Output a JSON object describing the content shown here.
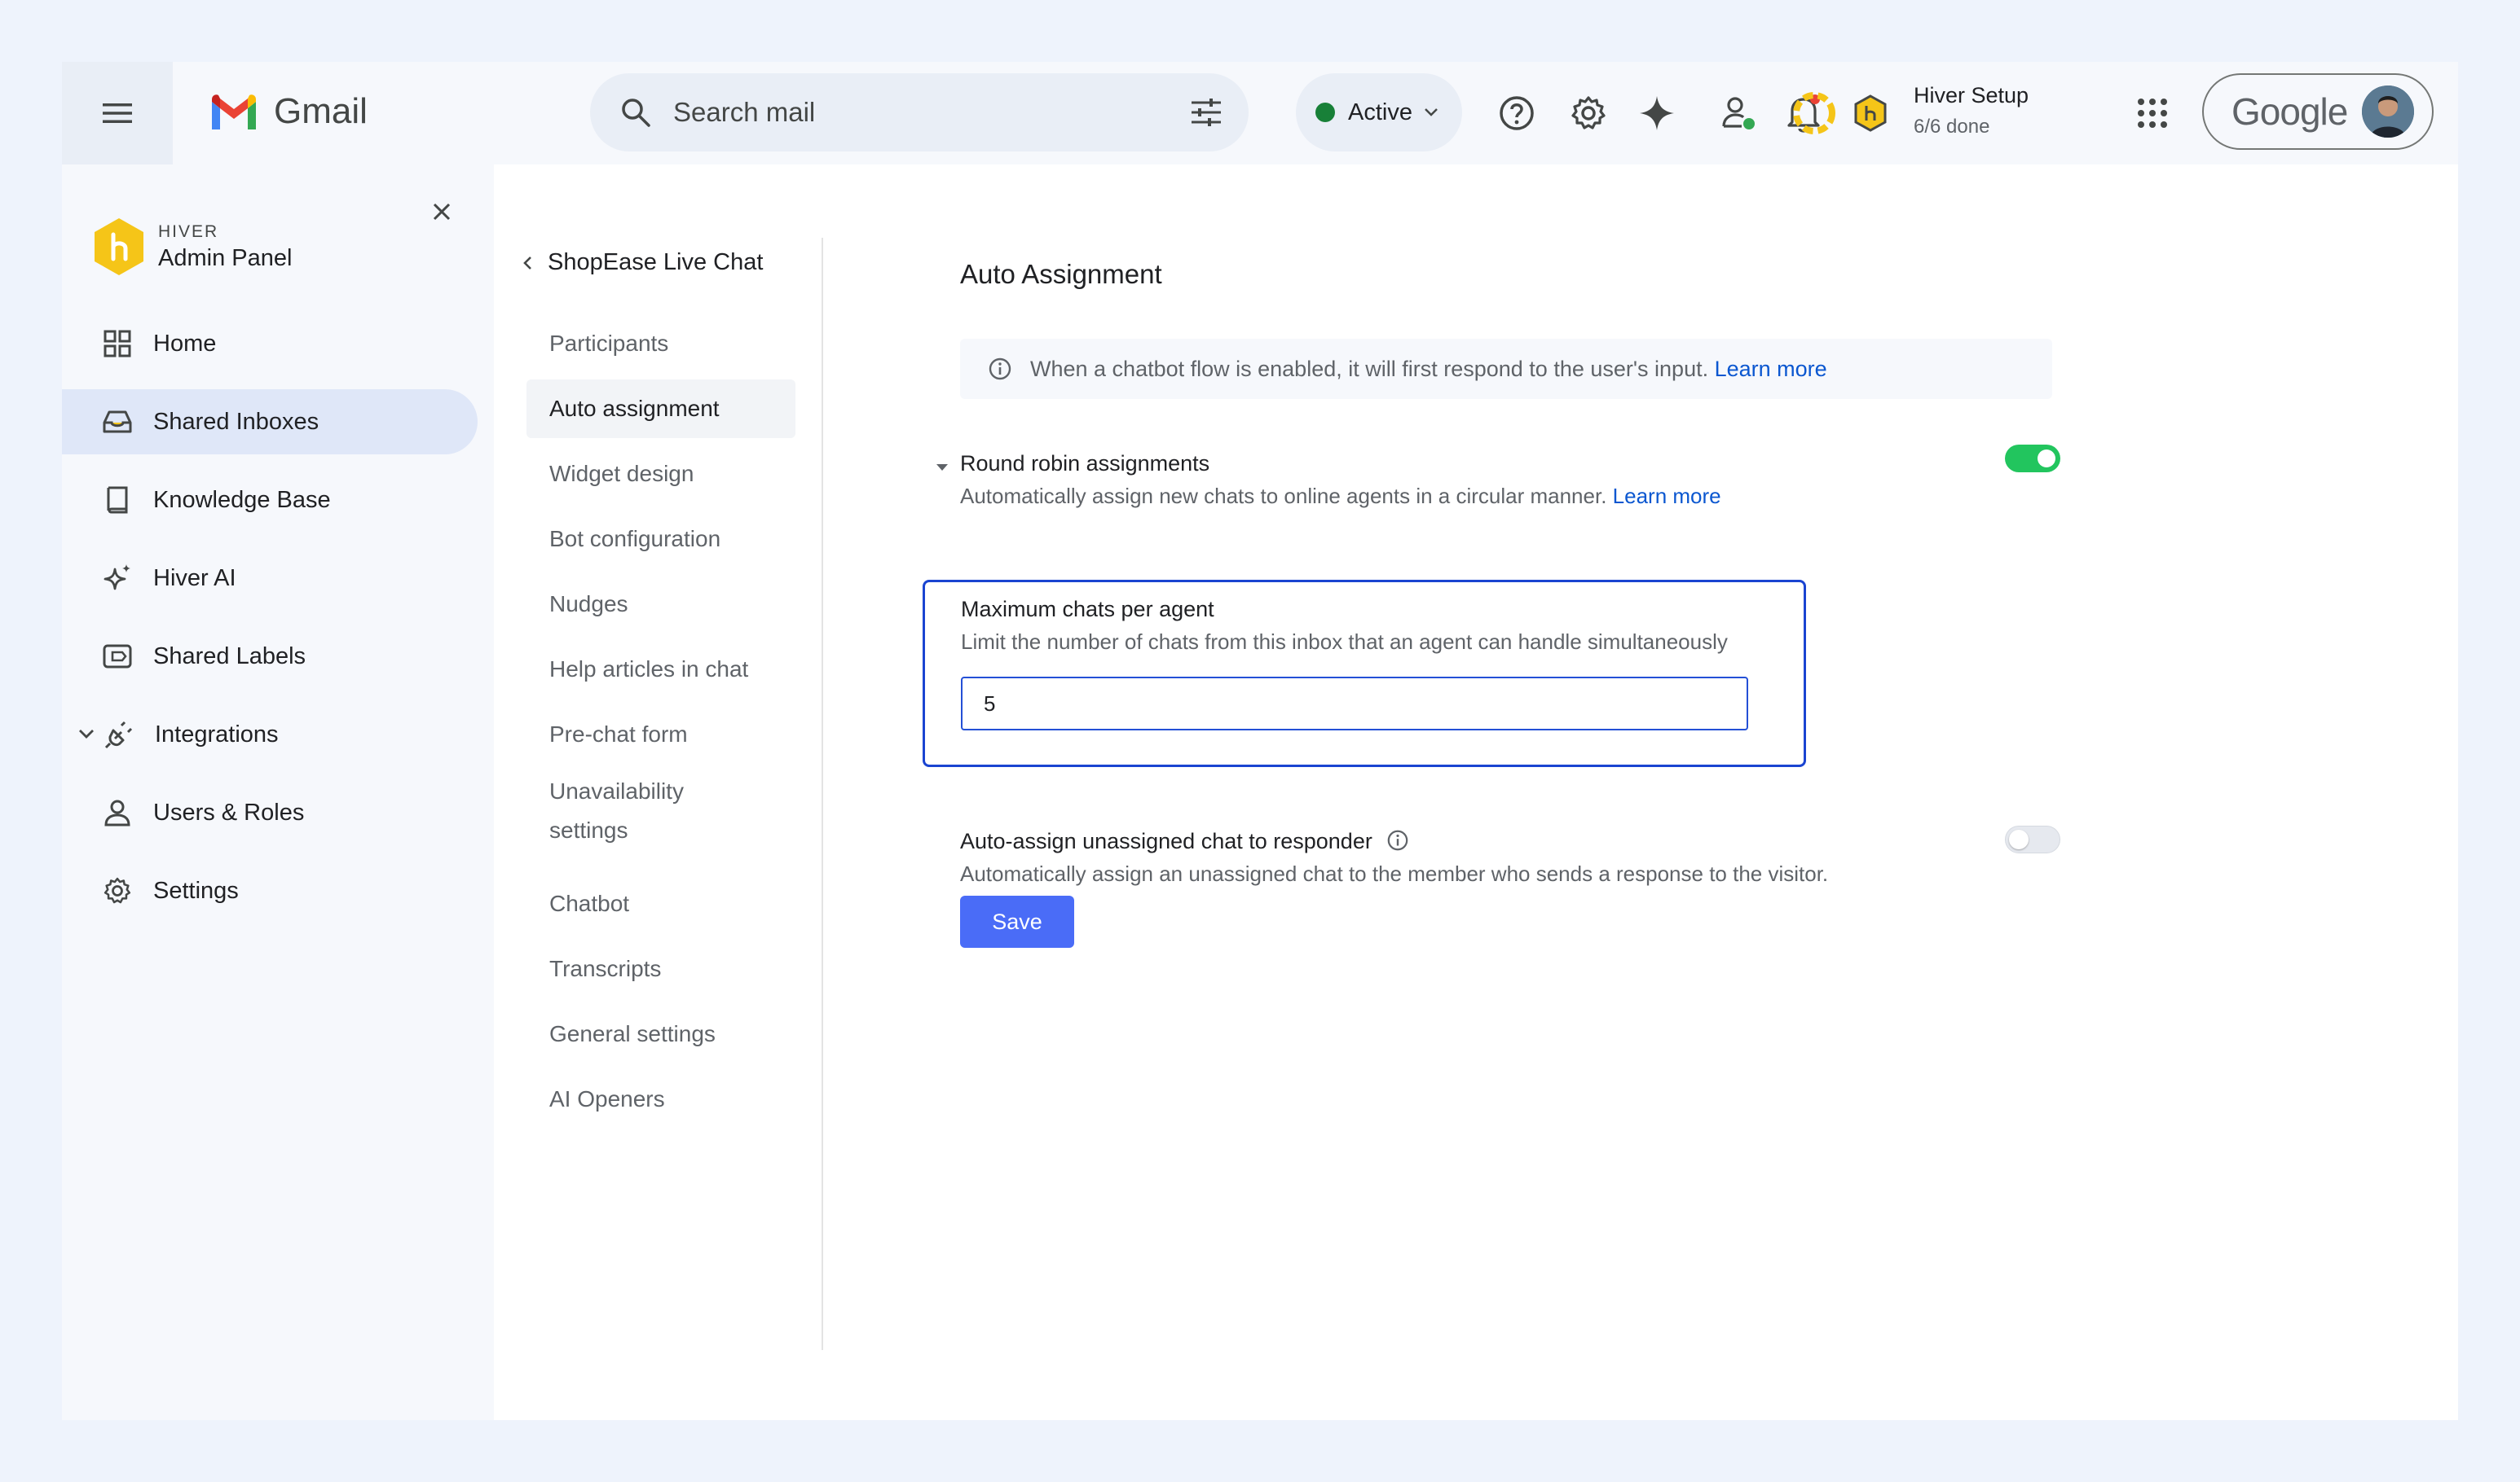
{
  "topbar": {
    "app_name": "Gmail",
    "search_placeholder": "Search mail",
    "status_label": "Active",
    "setup_title": "Hiver Setup",
    "setup_progress": "6/6 done",
    "account_brand": "Google",
    "status_color": "#188038",
    "notification_dot_color": "#ea4335"
  },
  "sidebar": {
    "brand_small": "HIVER",
    "brand_title": "Admin Panel",
    "items": [
      {
        "label": "Home",
        "icon": "grid-icon"
      },
      {
        "label": "Shared Inboxes",
        "icon": "inbox-icon",
        "active": true
      },
      {
        "label": "Knowledge Base",
        "icon": "book-icon"
      },
      {
        "label": "Hiver AI",
        "icon": "sparkle-icon"
      },
      {
        "label": "Shared Labels",
        "icon": "label-icon"
      },
      {
        "label": "Integrations",
        "icon": "plug-icon",
        "expandable": true
      },
      {
        "label": "Users & Roles",
        "icon": "user-icon"
      },
      {
        "label": "Settings",
        "icon": "gear-icon"
      }
    ]
  },
  "subnav": {
    "back_title": "ShopEase Live Chat",
    "items": [
      "Participants",
      "Auto assignment",
      "Widget design",
      "Bot configuration",
      "Nudges",
      "Help articles in chat",
      "Pre-chat form",
      "Unavailability settings",
      "Chatbot",
      "Transcripts",
      "General settings",
      "AI Openers"
    ],
    "active_index": 1
  },
  "main": {
    "title": "Auto Assignment",
    "banner_text": "When a chatbot flow is enabled, it will first respond to the user's input.",
    "banner_link": "Learn more",
    "round_robin": {
      "title": "Round robin assignments",
      "desc": "Automatically assign new chats to online agents in a circular manner.",
      "link": "Learn more",
      "enabled": true
    },
    "max_chats": {
      "title": "Maximum chats per agent",
      "desc": "Limit the number of chats from this inbox that an agent can handle simultaneously",
      "value": "5"
    },
    "auto_assign_responder": {
      "title": "Auto-assign unassigned chat to responder",
      "desc": "Automatically assign an unassigned chat to the member who sends a response to the visitor.",
      "enabled": false
    },
    "save_label": "Save"
  },
  "colors": {
    "accent": "#4a6cf7",
    "toggle_on": "#22c55e",
    "link": "#0b57d0",
    "hiver_yellow": "#f5c518"
  }
}
